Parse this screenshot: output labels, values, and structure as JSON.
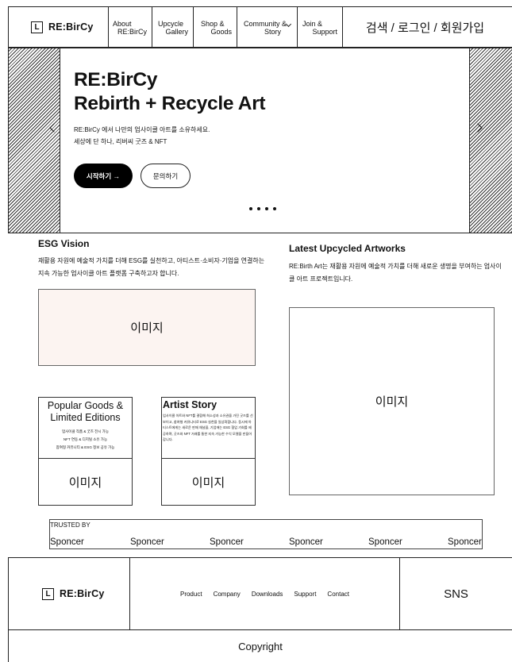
{
  "header": {
    "logo_mark": "L",
    "logo_text": "RE:BirCy",
    "nav": [
      {
        "l1": "About",
        "l2": "RE:BirCy"
      },
      {
        "l1": "Upcycle",
        "l2": "Gallery"
      },
      {
        "l1": "Shop &",
        "l2": "Goods"
      },
      {
        "l1": "Community &",
        "l2": "Story"
      },
      {
        "l1": "Join &",
        "l2": "Support"
      }
    ],
    "right_text": "검색 / 로그인 / 회원가입"
  },
  "hero": {
    "title_line1": "RE:BirCy",
    "title_line2": "Rebirth + Recycle Art",
    "desc_line1": "RE:BirCy 에서 나만의 업사이클 아트를 소유하세요.",
    "desc_line2": "세상에 단 하나, 리버씨 굿즈 & NFT",
    "primary_button": "시작하기 →",
    "secondary_button": "문의하기"
  },
  "esg": {
    "title": "ESG Vision",
    "desc": "재활용 자원에 예술적 가치를 더해 ESG를 실천하고, 아티스트·소비자·기업을 연결하는 지속 가능한 업사이클 아트 플랫폼 구축하고자 합니다.",
    "image_label": "이미지"
  },
  "latest": {
    "title": "Latest Upcycled Artworks",
    "desc": "RE:Birth Art는 재활용 자원에 예술적 가치를 더해 새로운 생명을 부여하는 업사이클 아트 프로젝트입니다.",
    "image_label": "이미지"
  },
  "cards": {
    "goods": {
      "title": "Popular Goods & Limited Editions",
      "sub1": "업사이클 작품 & 굿즈 전시 가능",
      "sub2": "NFT 연동 & 디지털 소유 가능",
      "sub3": "참여형 커뮤니티 & ESG 정보 공유 가능",
      "image_label": "이미지"
    },
    "artist": {
      "title": "Artist Story",
      "text": "업사이클 아트와 NFT를 결합해 희소성과 소유권을 가진 굿즈를 선보이고, 참여형 커뮤니티로 ESG 실천을 일상화합니다. 동시에 아티스트에게는 새로운 판매 채널을, 기업에는 ESG 협업 기회를 제공하며, 굿즈와 NFT 거래를 통한 지속 가능한 수익 모델을 만들어갑니다.",
      "image_label": "이미지"
    }
  },
  "trusted": {
    "label": "TRUSTED BY",
    "sponsors": [
      "Sponcer",
      "Sponcer",
      "Sponcer",
      "Sponcer",
      "Sponcer",
      "Sponcer"
    ]
  },
  "footer": {
    "logo_mark": "L",
    "logo_text": "RE:BirCy",
    "links": [
      "Product",
      "Company",
      "Downloads",
      "Support",
      "Contact"
    ],
    "sns": "SNS",
    "copyright": "Copyright"
  }
}
